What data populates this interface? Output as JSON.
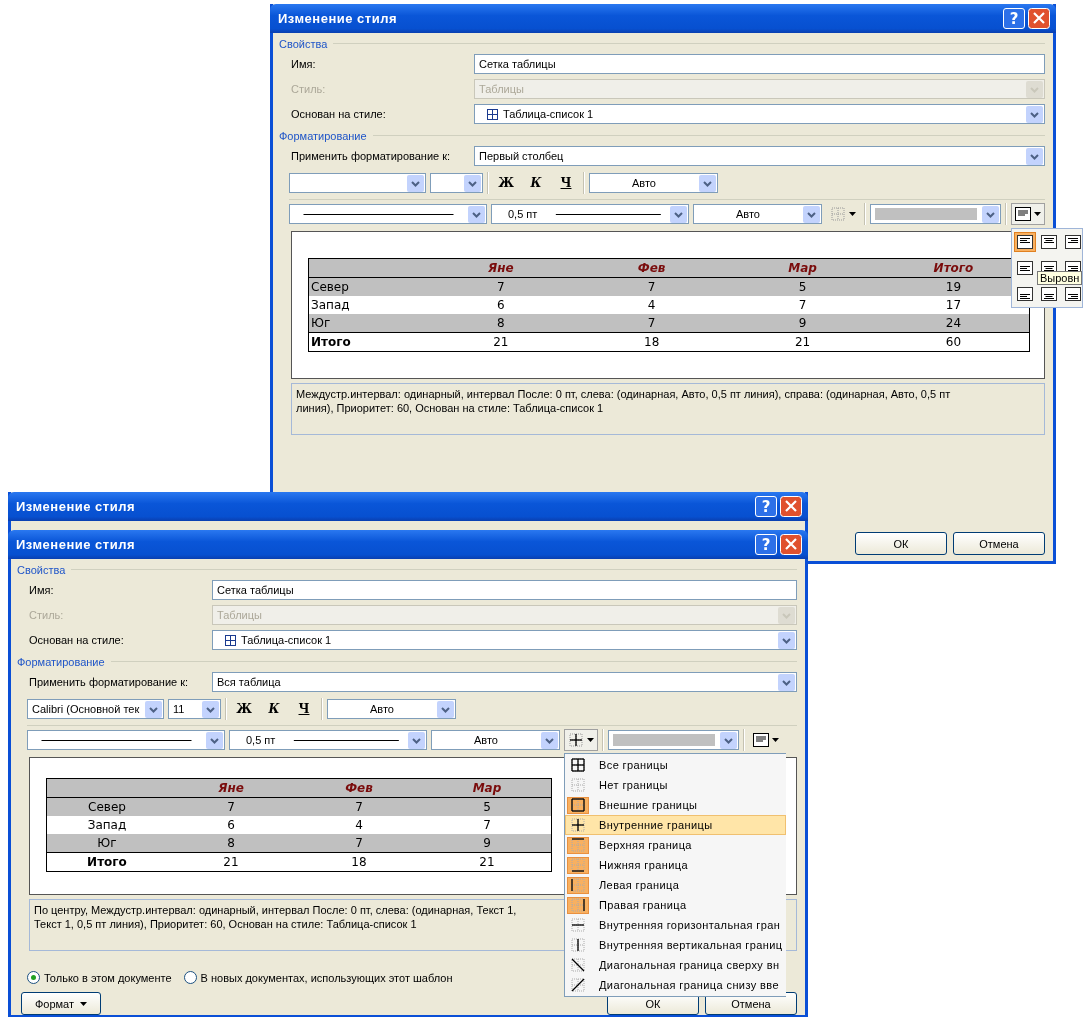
{
  "dialogs": [
    {
      "kind": "full",
      "title": "Изменение стиля",
      "help": "?",
      "properties_heading": "Свойства",
      "fields": [
        {
          "kind": "text",
          "label": "Имя:",
          "value": "Сетка таблицы",
          "disabled": false
        },
        {
          "kind": "select",
          "label": "Стиль:",
          "value": "Таблицы",
          "disabled": true
        },
        {
          "kind": "style-select",
          "label": "Основан на стиле:",
          "value": "Таблица-список 1",
          "disabled": false
        }
      ],
      "formatting_heading": "Форматирование",
      "apply": {
        "label": "Применить форматирование к:",
        "value": "Первый столбец"
      },
      "style_buttons": [
        "Ж",
        "К",
        "Ч"
      ],
      "font_color": "Авто",
      "line_width": "0,5 пт",
      "line_color": "Авто",
      "align_popup": {
        "tooltip": "Выровн",
        "options": [
          {
            "kind": "top-left",
            "selected": true
          },
          {
            "kind": "top-center",
            "selected": false
          },
          {
            "kind": "top-right",
            "selected": false
          },
          {
            "kind": "middle-left",
            "selected": false
          },
          {
            "kind": "middle-center",
            "selected": false
          },
          {
            "kind": "middle-right",
            "selected": false
          },
          {
            "kind": "bottom-left",
            "selected": false
          },
          {
            "kind": "bottom-center",
            "selected": false
          },
          {
            "kind": "bottom-right",
            "selected": false
          }
        ]
      },
      "preview": {
        "kind": "left",
        "columns": [
          "",
          "Яне",
          "Фев",
          "Мар",
          "Итого"
        ],
        "rows": [
          {
            "kind": "band",
            "cells": [
              "Север",
              "7",
              "7",
              "5",
              "19"
            ]
          },
          {
            "kind": "plain",
            "cells": [
              "Запад",
              "6",
              "4",
              "7",
              "17"
            ]
          },
          {
            "kind": "band",
            "cells": [
              "Юг",
              "8",
              "7",
              "9",
              "24"
            ]
          },
          {
            "kind": "total",
            "cells": [
              "Итого",
              "21",
              "18",
              "21",
              "60"
            ]
          }
        ]
      },
      "description": [
        "Междустр.интервал:  одинарный, интервал После:  0 пт, слева: (одинарная, Авто,  0,5 пт линия), справа: (одинарная, Авто,  0,5 пт",
        "линия), Приоритет: 60, Основан на стиле: Таблица-список 1"
      ],
      "buttons": [
        "ОК",
        "Отмена"
      ]
    },
    {
      "kind": "titlebar",
      "title": "Изменение стиля",
      "help": "?"
    },
    {
      "kind": "full",
      "title": "Изменение стиля",
      "help": "?",
      "properties_heading": "Свойства",
      "fields": [
        {
          "kind": "text",
          "label": "Имя:",
          "value": "Сетка таблицы",
          "disabled": false
        },
        {
          "kind": "select",
          "label": "Стиль:",
          "value": "Таблицы",
          "disabled": true
        },
        {
          "kind": "style-select",
          "label": "Основан на стиле:",
          "value": "Таблица-список 1",
          "disabled": false
        }
      ],
      "formatting_heading": "Форматирование",
      "apply": {
        "label": "Применить форматирование к:",
        "value": "Вся таблица"
      },
      "font_value": "Calibri (Основной тек",
      "size_value": "11",
      "style_buttons": [
        "Ж",
        "К",
        "Ч"
      ],
      "font_color": "Авто",
      "line_width": "0,5 пт",
      "line_color": "Авто",
      "border_menu": [
        {
          "label": "Все границы",
          "kind": "all",
          "active": false,
          "selected": false
        },
        {
          "label": "Нет границы",
          "kind": "none",
          "active": false,
          "selected": false
        },
        {
          "label": "Внешние границы",
          "kind": "outside",
          "active": true,
          "selected": false
        },
        {
          "label": "Внутренние границы",
          "kind": "inside",
          "active": false,
          "selected": true
        },
        {
          "label": "Верхняя граница",
          "kind": "top",
          "active": true,
          "selected": false
        },
        {
          "label": "Нижняя граница",
          "kind": "bottom",
          "active": true,
          "selected": false
        },
        {
          "label": "Левая граница",
          "kind": "left",
          "active": true,
          "selected": false
        },
        {
          "label": "Правая граница",
          "kind": "right",
          "active": true,
          "selected": false
        },
        {
          "label": "Внутренняя горизонтальная гран",
          "kind": "inner-h",
          "active": false,
          "selected": false
        },
        {
          "label": "Внутренняя вертикальная границ",
          "kind": "inner-v",
          "active": false,
          "selected": false
        },
        {
          "label": "Диагональная граница сверху вн",
          "kind": "diag-down",
          "active": false,
          "selected": false
        },
        {
          "label": "Диагональная граница снизу вве",
          "kind": "diag-up",
          "active": false,
          "selected": false
        }
      ],
      "preview": {
        "kind": "center",
        "columns": [
          "",
          "Яне",
          "Фев",
          "Мар"
        ],
        "rows": [
          {
            "kind": "band",
            "cells": [
              "Север",
              "7",
              "7",
              "5"
            ]
          },
          {
            "kind": "plain",
            "cells": [
              "Запад",
              "6",
              "4",
              "7"
            ]
          },
          {
            "kind": "band",
            "cells": [
              "Юг",
              "8",
              "7",
              "9"
            ]
          },
          {
            "kind": "total",
            "cells": [
              "Итого",
              "21",
              "18",
              "21"
            ]
          }
        ]
      },
      "description": [
        "По центру, Междустр.интервал:  одинарный, интервал После:  0 пт, слева: (одинарная, Текст 1,",
        "Текст 1,  0,5 пт линия), Приоритет: 60, Основан на стиле: Таблица-список 1"
      ],
      "options": [
        {
          "label": "Только в этом документе",
          "selected": true
        },
        {
          "label": "В новых документах, использующих этот шаблон",
          "selected": false
        }
      ],
      "format_button": "Формат",
      "buttons": [
        "ОК",
        "Отмена"
      ]
    }
  ]
}
